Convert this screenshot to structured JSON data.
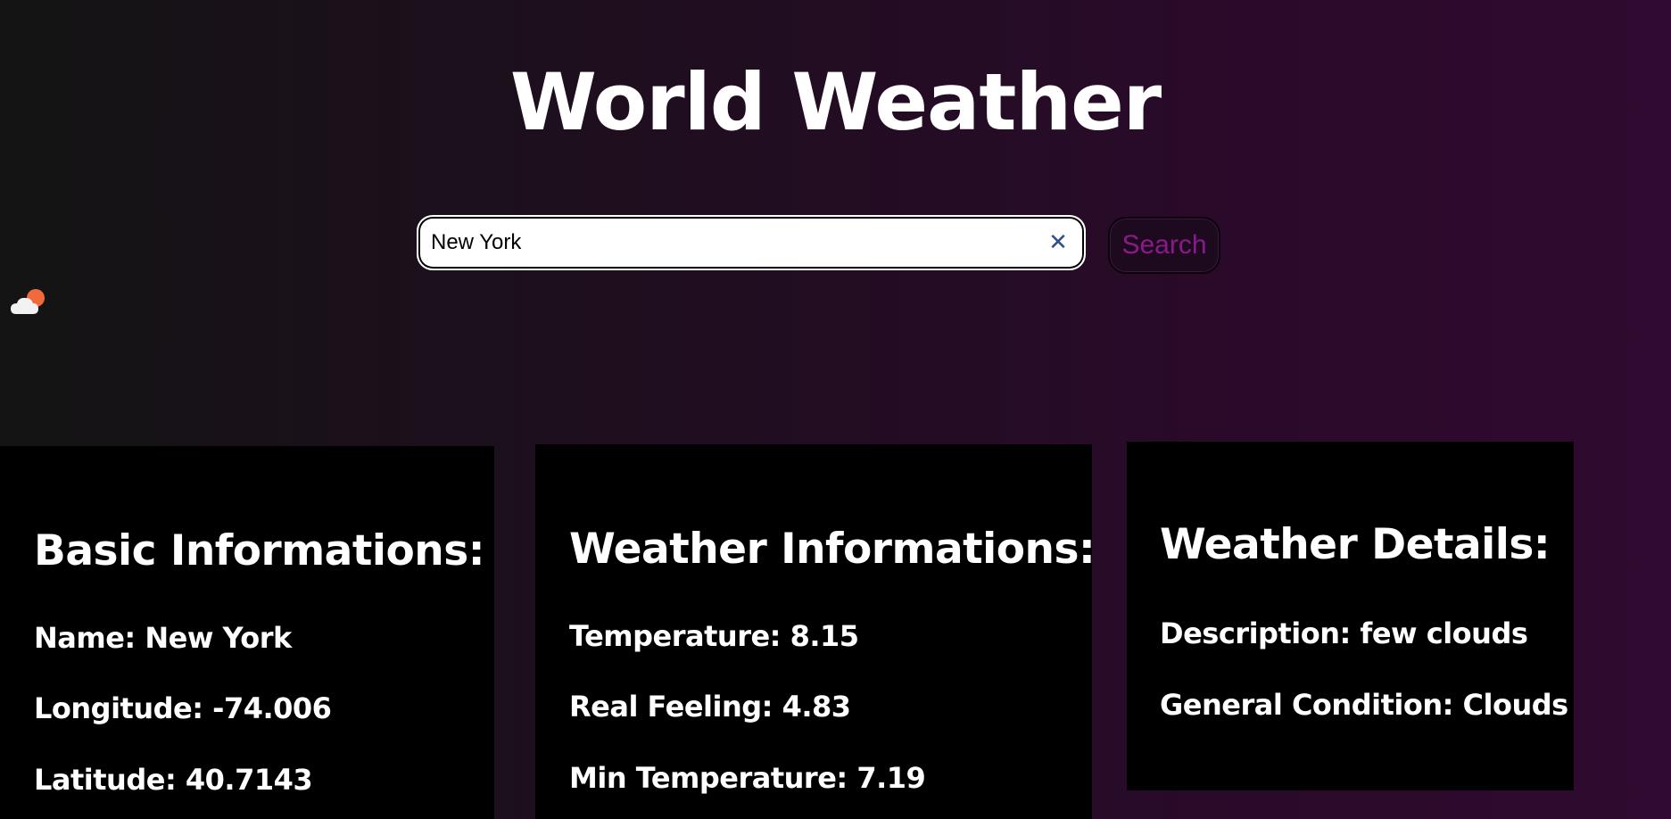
{
  "header": {
    "title": "World Weather"
  },
  "search": {
    "value": "New York",
    "clear_icon": "close-icon",
    "button_label": "Search"
  },
  "weather_icon": {
    "name": "partly-cloudy-icon",
    "cloud_color": "#f2f2f2",
    "sun_color": "#f06a3c"
  },
  "basic": {
    "heading": "Basic Informations:",
    "name": "Name: New York",
    "longitude": "Longitude: -74.006",
    "latitude": "Latitude: 40.7143"
  },
  "weather": {
    "heading": "Weather Informations:",
    "temperature": "Temperature: 8.15",
    "real_feeling": "Real Feeling: 4.83",
    "min_temperature": "Min Temperature: 7.19"
  },
  "details": {
    "heading": "Weather Details:",
    "description": "Description: few clouds",
    "general_condition": "General Condition: Clouds"
  },
  "colors": {
    "accent": "#8a1a8a",
    "card_background": "#000000",
    "background_start": "#141414",
    "background_end": "#300a30"
  }
}
